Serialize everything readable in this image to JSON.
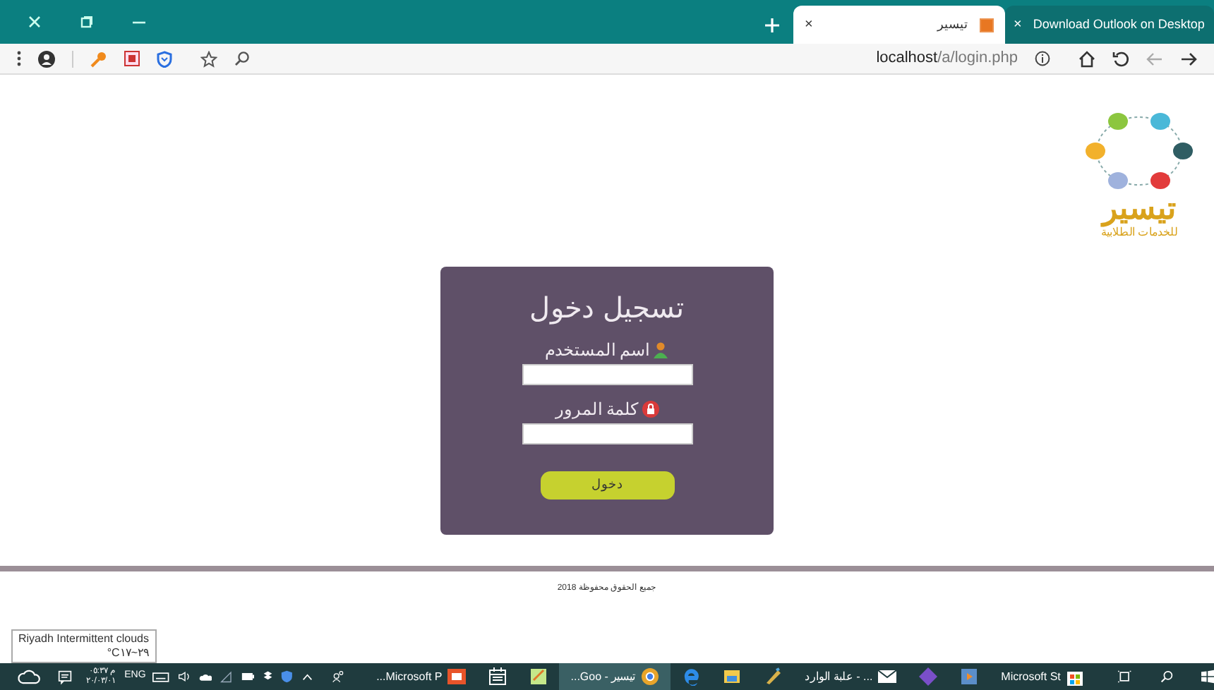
{
  "browser": {
    "tabs": [
      {
        "title": "Download Outlook on Desktop",
        "close": "×",
        "selected": false
      },
      {
        "title": "تيسير",
        "close": "×",
        "selected": true
      }
    ],
    "address": {
      "host": "localhost",
      "path": "/a/login.php"
    }
  },
  "login": {
    "title": "تسجيل دخول",
    "fields": [
      {
        "label": "اسم المستخدم",
        "kind": "user"
      },
      {
        "label": "كلمة المرور",
        "kind": "password"
      }
    ],
    "button": "دخول"
  },
  "logo": {
    "text": "تيسير",
    "tagline": "للخدمات الطلابية"
  },
  "footer": "جميع الحقوق محفوظة 2018",
  "weather_tooltip": [
    "Riyadh Intermittent clouds",
    "°C٢٩~١٧"
  ],
  "taskbar": {
    "clock": {
      "time": "م ٠٥:٣٧",
      "date": "٢٠/٠٣/٠١"
    },
    "language": "ENG",
    "apps": [
      {
        "label": "Microsoft St",
        "kind": "store",
        "active": false
      },
      {
        "kind": "media",
        "active": false
      },
      {
        "kind": "studio",
        "active": false
      },
      {
        "label": "علبة الوارد - ...",
        "kind": "mail",
        "active": false
      },
      {
        "kind": "pen",
        "active": false
      },
      {
        "kind": "folder",
        "active": false
      },
      {
        "kind": "edge",
        "active": false
      },
      {
        "label": "...Goo - تيسير",
        "kind": "browser",
        "active": true
      },
      {
        "kind": "notes",
        "active": false
      },
      {
        "kind": "calendar",
        "active": false
      },
      {
        "label": "...Microsoft P",
        "kind": "slides",
        "active": false
      }
    ]
  }
}
